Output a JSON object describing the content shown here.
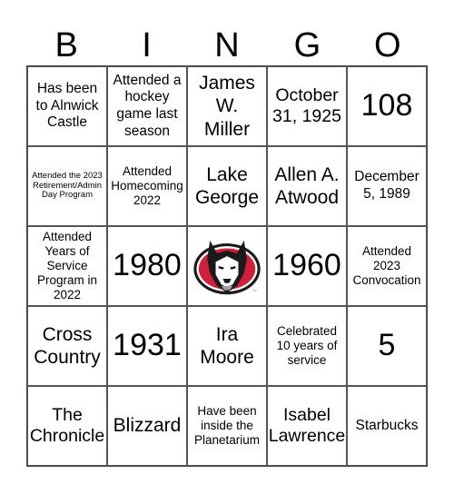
{
  "header": {
    "letters": [
      "B",
      "I",
      "N",
      "G",
      "O"
    ]
  },
  "colors": {
    "logo_red": "#cf1f3c",
    "logo_black": "#1a1a1a",
    "grid_line": "#555555"
  },
  "grid": {
    "rows": [
      [
        "Has been to Alnwick Castle",
        "Attended a hockey game last season",
        "James W. Miller",
        "October 31, 1925",
        "108"
      ],
      [
        "Attended the 2023 Retirement/Admin Day Program",
        "Attended Homecoming 2022",
        "Lake George",
        "Allen A. Atwood",
        "December 5, 1989"
      ],
      [
        "Attended Years of Service Program in 2022",
        "1980",
        "free-space-logo",
        "1960",
        "Attended 2023 Convocation"
      ],
      [
        "Cross Country",
        "1931",
        "Ira Moore",
        "Celebrated 10 years of service",
        "5"
      ],
      [
        "The Chronicle",
        "Blizzard",
        "Have been inside the Planetarium",
        "Isabel Lawrence",
        "Starbucks"
      ]
    ],
    "free_space": {
      "icon": "husky-mascot-logo",
      "trademark": "TM"
    }
  }
}
